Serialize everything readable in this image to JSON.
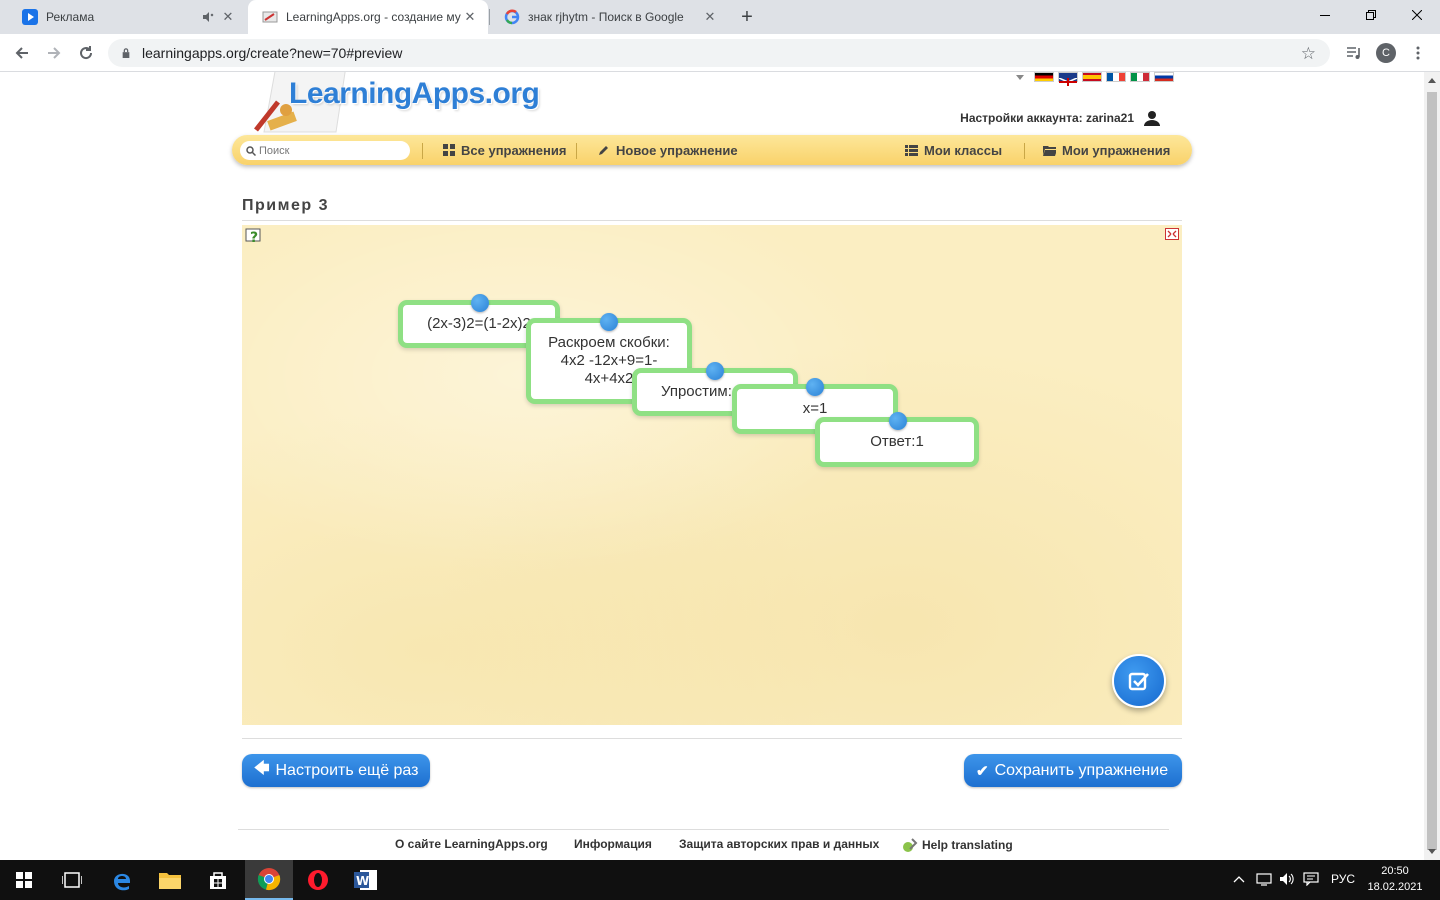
{
  "browser": {
    "tabs": [
      {
        "title": "Реклама",
        "icon": "play-icon",
        "muted": true
      },
      {
        "title": "LearningApps.org - создание му",
        "icon": "learningapps-icon",
        "active": true
      },
      {
        "title": "знак rjhytm - Поиск в Google",
        "icon": "google-icon"
      }
    ],
    "url": "learningapps.org/create?new=70#preview",
    "profile_initial": "C"
  },
  "site": {
    "logo": "LearningApps.org",
    "account_label": "Настройки аккаунта: zarina21",
    "search_placeholder": "Поиск",
    "nav": {
      "all_exercises": "Все упражнения",
      "new_exercise": "Новое упражнение",
      "my_classes": "Мои классы",
      "my_exercises": "Мои упражнения"
    }
  },
  "exercise": {
    "title": "Пример 3",
    "cards": [
      {
        "text": "(2x-3)2=(1-2x)2"
      },
      {
        "text": "Раскроем скобки: 4x2 -12x+9=1-4x+4x2"
      },
      {
        "text": "Упростим: 8x=8"
      },
      {
        "text": "x=1"
      },
      {
        "text": "Ответ:1"
      }
    ]
  },
  "buttons": {
    "reconfigure": "Настроить ещё раз",
    "save": "Сохранить упражнение"
  },
  "footer": {
    "about": "О сайте LearningApps.org",
    "info": "Информация",
    "privacy": "Защита авторских прав и данных",
    "translate": "Help translating"
  },
  "taskbar": {
    "lang": "РУС",
    "time": "20:50",
    "date": "18.02.2021"
  }
}
